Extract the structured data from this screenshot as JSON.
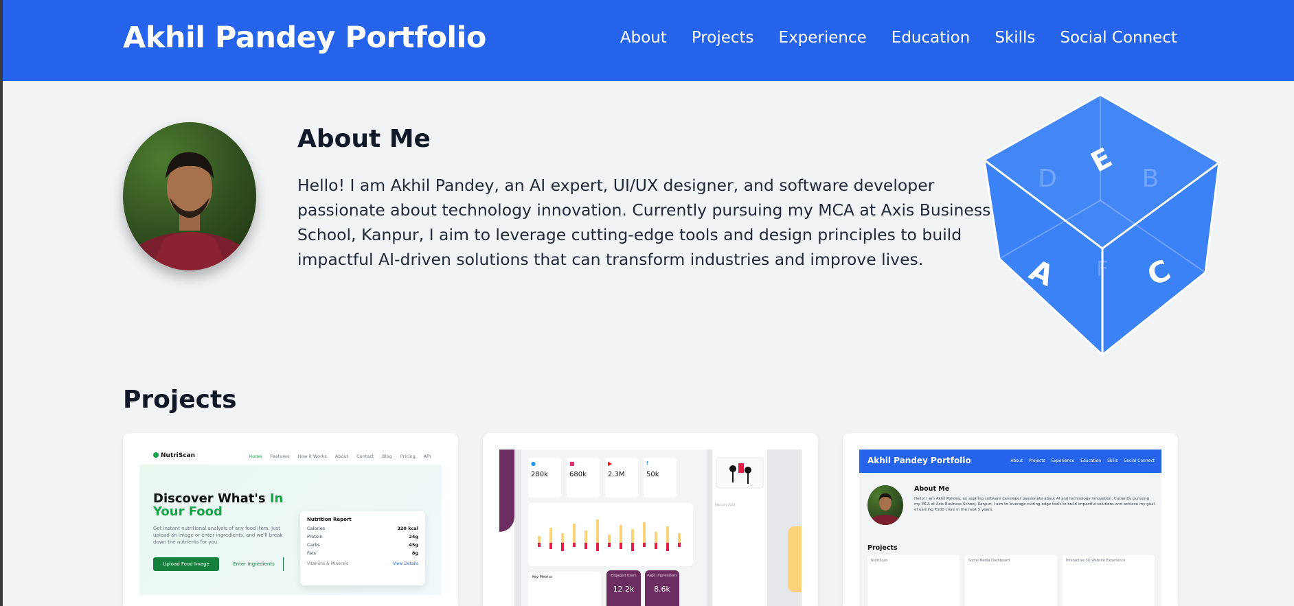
{
  "header": {
    "brand": "Akhil Pandey Portfolio",
    "nav": [
      "About",
      "Projects",
      "Experience",
      "Education",
      "Skills",
      "Social Connect"
    ]
  },
  "about": {
    "title": "About Me",
    "text": "Hello! I am Akhil Pandey, an AI expert, UI/UX designer, and software developer passionate about technology innovation. Currently pursuing my MCA at Axis Business School, Kanpur, I aim to leverage cutting-edge tools and design principles to build impactful AI-driven solutions that can transform industries and improve lives."
  },
  "cube": {
    "letters": [
      "E",
      "D",
      "B",
      "A",
      "F",
      "C"
    ],
    "color": "#3b82f6"
  },
  "projects": {
    "title": "Projects",
    "nutriscan": {
      "logo": "NutriScan",
      "nav": [
        "Home",
        "Features",
        "How it Works",
        "About",
        "Contact",
        "Blog",
        "Pricing",
        "API"
      ],
      "heading_part1": "Discover What's ",
      "heading_accent": "In Your Food",
      "description": "Get instant nutritional analysis of any food item. Just upload an image or enter ingredients, and we'll break down the nutrients for you.",
      "button_upload": "Upload Food Image",
      "button_enter": "Enter Ingredients",
      "report_title": "Nutrition Report",
      "report_rows": [
        {
          "label": "Calories",
          "value": "320 kcal"
        },
        {
          "label": "Protein",
          "value": "24g"
        },
        {
          "label": "Carbs",
          "value": "45g"
        },
        {
          "label": "Fats",
          "value": "8g"
        }
      ],
      "report_footer": "Vitamins & Minerals",
      "report_link": "View Details"
    },
    "dashboard": {
      "stats": [
        {
          "icon": "twitter-icon",
          "value": "280k",
          "color": "#1d9bf0"
        },
        {
          "icon": "instagram-icon",
          "value": "680k",
          "color": "#e1306c"
        },
        {
          "icon": "youtube-icon",
          "value": "2.3M",
          "color": "#ff0000"
        },
        {
          "icon": "facebook-icon",
          "value": "50k",
          "color": "#1877f2"
        }
      ],
      "tiles": [
        {
          "label": "Engaged Users",
          "value": "12.2k"
        },
        {
          "label": "Page Impressions",
          "value": "8.6k"
        }
      ],
      "bottom_title": "Key Metrics",
      "calendar_title": "February 2022"
    },
    "portfolio_preview": {
      "brand": "Akhil Pandey Portfolio",
      "nav": [
        "About",
        "Projects",
        "Experience",
        "Education",
        "Skills",
        "Social Connect"
      ],
      "about_title": "About Me",
      "about_text": "Hello! I am Akhil Pandey, an aspiring software developer passionate about AI and technology innovation. Currently pursuing my MCA at Axis Business School, Kanpur, I aim to leverage cutting-edge tools to build impactful solutions and achieve my goal of earning ₹100 crore in the next 5 years.",
      "projects_title": "Projects",
      "cards": [
        "NutriScan",
        "Social Media Dashboard",
        "Interactive 3D Website Experience"
      ]
    }
  }
}
